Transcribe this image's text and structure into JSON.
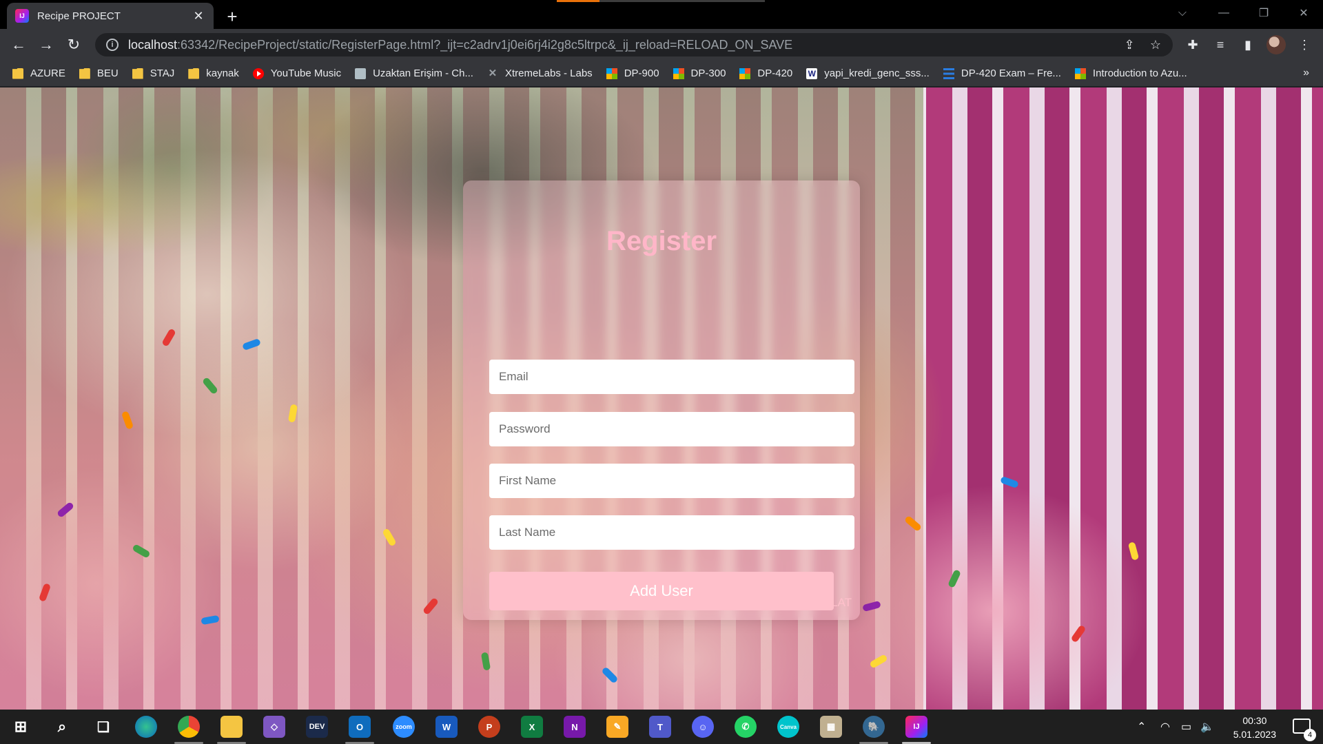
{
  "browser": {
    "tab": {
      "title": "Recipe PROJECT",
      "close_icon": "close-icon"
    },
    "new_tab_label": "+",
    "url": {
      "host": "localhost",
      "rest": ":63342/RecipeProject/static/RegisterPage.html?_ijt=c2adrv1j0ei6rj4i2g8c5ltrpc&_ij_reload=RELOAD_ON_SAVE"
    },
    "bookmarks": [
      {
        "label": "AZURE",
        "icon": "folder-icon"
      },
      {
        "label": "BEU",
        "icon": "folder-icon"
      },
      {
        "label": "STAJ",
        "icon": "folder-icon"
      },
      {
        "label": "kaynak",
        "icon": "folder-icon"
      },
      {
        "label": "YouTube Music",
        "icon": "youtube-music-icon"
      },
      {
        "label": "Uzaktan Erişim - Ch...",
        "icon": "remote-access-icon"
      },
      {
        "label": "XtremeLabs - Labs",
        "icon": "x-icon"
      },
      {
        "label": "DP-900",
        "icon": "microsoft-icon"
      },
      {
        "label": "DP-300",
        "icon": "microsoft-icon"
      },
      {
        "label": "DP-420",
        "icon": "microsoft-icon"
      },
      {
        "label": "yapi_kredi_genc_sss...",
        "icon": "word-icon"
      },
      {
        "label": "DP-420 Exam – Fre...",
        "icon": "document-icon"
      },
      {
        "label": "Introduction to Azu...",
        "icon": "microsoft-icon"
      }
    ],
    "more_bookmarks": "»"
  },
  "page": {
    "title": "Register",
    "fields": {
      "email_placeholder": "Email",
      "password_placeholder": "Password",
      "first_name_placeholder": "First Name",
      "last_name_placeholder": "Last Name"
    },
    "submit_label": "Add User",
    "author": "Basak AHLAT"
  },
  "taskbar": {
    "apps": [
      "start-icon",
      "search-icon",
      "task-view-icon",
      "edge-icon",
      "chrome-icon",
      "file-explorer-icon",
      "visual-studio-icon",
      "dev-icon",
      "outlook-icon",
      "zoom-icon",
      "word-icon",
      "powerpoint-icon",
      "excel-icon",
      "onenote-icon",
      "pdf-icon",
      "teams-icon",
      "discord-icon",
      "whatsapp-icon",
      "canva-icon",
      "game-icon",
      "postgres-icon",
      "intellij-icon"
    ],
    "dev_label": "DEV",
    "zoom_label": "zoom",
    "word_label": "W",
    "ppt_label": "P",
    "excel_label": "X",
    "onenote_label": "N",
    "canva_label": "Canva",
    "intellij_label": "IJ",
    "time": "00:30",
    "date": "5.01.2023",
    "notification_count": "4"
  },
  "colors": {
    "accent_pink": "#ffc0cb",
    "title_pink": "#ffb6c8",
    "chrome_dark": "#35363a"
  }
}
